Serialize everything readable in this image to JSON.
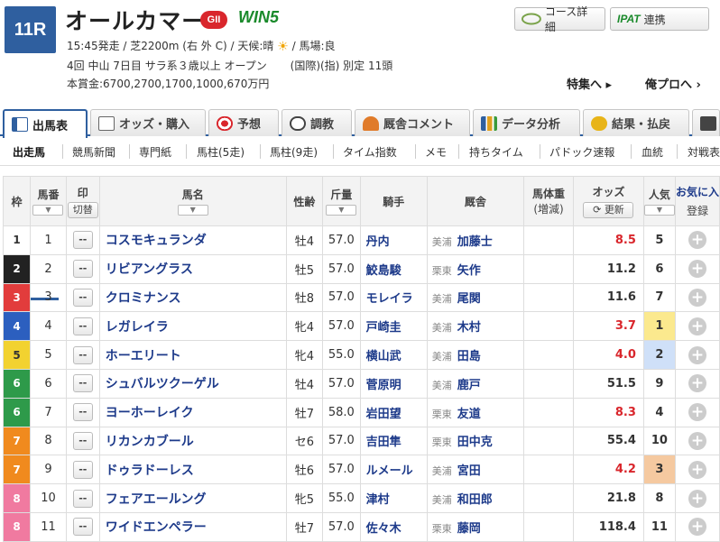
{
  "race": {
    "number": "11R",
    "name": "オールカマー",
    "grade": "GII",
    "win5": "WIN5",
    "start_line": "15:45発走 / 芝2200m (右 外 C) / 天候:晴",
    "baba": "/ 馬場:良",
    "cond_line": "4回 中山 7日目 サラ系３歳以上 オープン",
    "cond_line2": "(国際)(指) 別定 11頭",
    "prize_line": "本賞金:6700,2700,1700,1000,670万円"
  },
  "top_buttons": {
    "course": "コース詳細",
    "ipat_logo": "IPAT",
    "ipat": "連携"
  },
  "links": {
    "tokushu": "特集へ",
    "orepro": "俺プロへ"
  },
  "tabs": [
    {
      "label": "出馬表",
      "icon": "table-icon"
    },
    {
      "label": "オッズ・購入",
      "icon": "odds-icon"
    },
    {
      "label": "予想",
      "icon": "target-icon"
    },
    {
      "label": "調教",
      "icon": "stopwatch-icon"
    },
    {
      "label": "厩舎コメント",
      "icon": "stable-icon"
    },
    {
      "label": "データ分析",
      "icon": "bar-chart-icon"
    },
    {
      "label": "結果・払戻",
      "icon": "coins-icon"
    }
  ],
  "subnav": [
    "出走馬",
    "競馬新聞",
    "専門紙",
    "馬柱(5走)",
    "馬柱(9走)",
    "タイム指数",
    "メモ",
    "持ちタイム",
    "パドック速報",
    "血統",
    "対戦表"
  ],
  "headers": {
    "waku": "枠",
    "umaban": "馬番",
    "mark": "印",
    "kirikae": "切替",
    "horse": "馬名",
    "sexage": "性齢",
    "weight": "斤量",
    "jockey": "騎手",
    "stable": "厩舎",
    "bodyweight": "馬体重",
    "bodyweight2": "(増減)",
    "odds": "オッズ",
    "update": "更新",
    "pop": "人気",
    "fav": "お気に入",
    "login": "登録"
  },
  "mark_placeholder": "--",
  "colors": {
    "accent": "#2f5f9f",
    "hot_odds": "#d9262c"
  },
  "horses": [
    {
      "waku": "1",
      "num": "1",
      "name": "コスモキュランダ",
      "sexage": "牡4",
      "weight": "57.0",
      "jockey": "丹内",
      "loc": "美浦",
      "trainer": "加藤士",
      "odds": "8.5",
      "pop": "5",
      "hot": true
    },
    {
      "waku": "2",
      "num": "2",
      "name": "リビアングラス",
      "sexage": "牡5",
      "weight": "57.0",
      "jockey": "鮫島駿",
      "loc": "栗東",
      "trainer": "矢作",
      "odds": "11.2",
      "pop": "6",
      "hot": false
    },
    {
      "waku": "3",
      "num": "3",
      "name": "クロミナンス",
      "sexage": "牡8",
      "weight": "57.0",
      "jockey": "モレイラ",
      "loc": "美浦",
      "trainer": "尾関",
      "odds": "11.6",
      "pop": "7",
      "hot": false
    },
    {
      "waku": "4",
      "num": "4",
      "name": "レガレイラ",
      "sexage": "牝4",
      "weight": "57.0",
      "jockey": "戸崎圭",
      "loc": "美浦",
      "trainer": "木村",
      "odds": "3.7",
      "pop": "1",
      "hot": true
    },
    {
      "waku": "5",
      "num": "5",
      "name": "ホーエリート",
      "sexage": "牝4",
      "weight": "55.0",
      "jockey": "横山武",
      "loc": "美浦",
      "trainer": "田島",
      "odds": "4.0",
      "pop": "2",
      "hot": true
    },
    {
      "waku": "6",
      "num": "6",
      "name": "シュバルツクーゲル",
      "sexage": "牡4",
      "weight": "57.0",
      "jockey": "菅原明",
      "loc": "美浦",
      "trainer": "鹿戸",
      "odds": "51.5",
      "pop": "9",
      "hot": false
    },
    {
      "waku": "6",
      "num": "7",
      "name": "ヨーホーレイク",
      "sexage": "牡7",
      "weight": "58.0",
      "jockey": "岩田望",
      "loc": "栗東",
      "trainer": "友道",
      "odds": "8.3",
      "pop": "4",
      "hot": true
    },
    {
      "waku": "7",
      "num": "8",
      "name": "リカンカブール",
      "sexage": "セ6",
      "weight": "57.0",
      "jockey": "吉田隼",
      "loc": "栗東",
      "trainer": "田中克",
      "odds": "55.4",
      "pop": "10",
      "hot": false
    },
    {
      "waku": "7",
      "num": "9",
      "name": "ドゥラドーレス",
      "sexage": "牡6",
      "weight": "57.0",
      "jockey": "ルメール",
      "loc": "美浦",
      "trainer": "宮田",
      "odds": "4.2",
      "pop": "3",
      "hot": true
    },
    {
      "waku": "8",
      "num": "10",
      "name": "フェアエールング",
      "sexage": "牝5",
      "weight": "55.0",
      "jockey": "津村",
      "loc": "美浦",
      "trainer": "和田郎",
      "odds": "21.8",
      "pop": "8",
      "hot": false
    },
    {
      "waku": "8",
      "num": "11",
      "name": "ワイドエンペラー",
      "sexage": "牡7",
      "weight": "57.0",
      "jockey": "佐々木",
      "loc": "栗東",
      "trainer": "藤岡",
      "odds": "118.4",
      "pop": "11",
      "hot": false
    }
  ]
}
